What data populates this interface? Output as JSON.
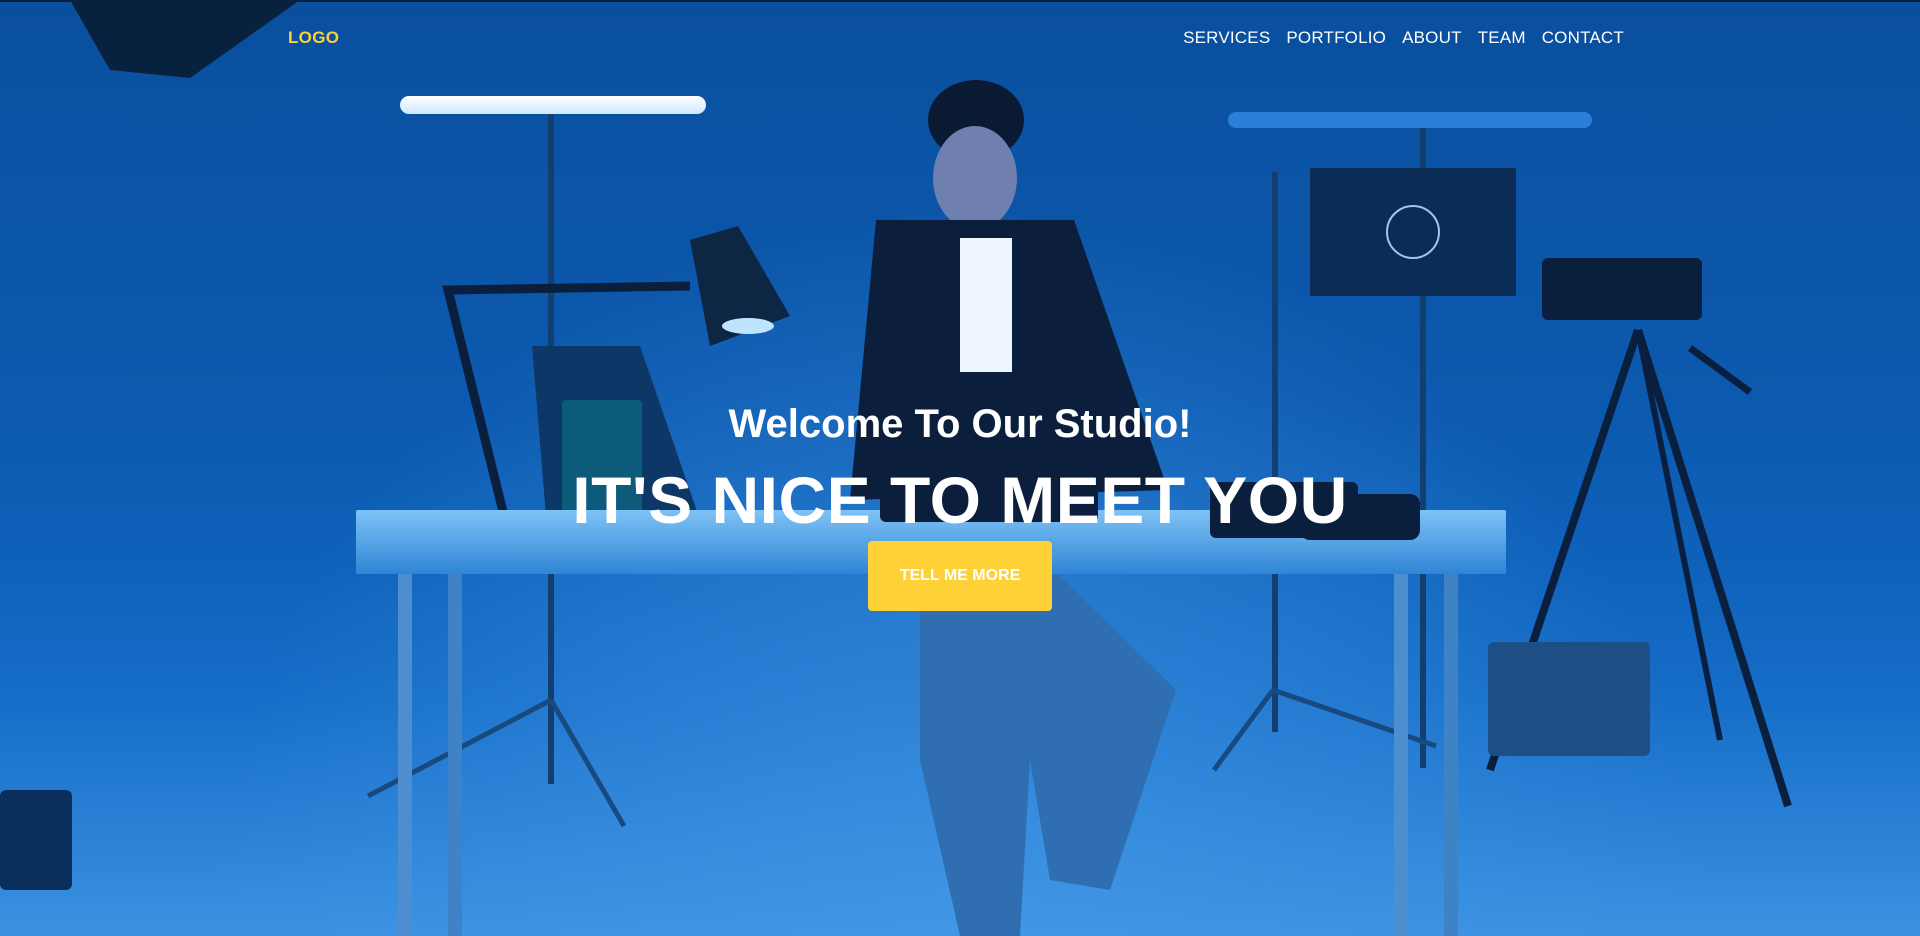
{
  "nav": {
    "logo": "LOGO",
    "links": [
      "SERVICES",
      "PORTFOLIO",
      "ABOUT",
      "TEAM",
      "CONTACT"
    ]
  },
  "hero": {
    "lead": "Welcome To Our Studio!",
    "heading": "IT'S NICE TO MEET YOU",
    "cta_label": "TELL ME MORE",
    "background_image": "photo studio with man at laptop on desk, blue lighting"
  },
  "colors": {
    "accent": "#fed136",
    "text": "#ffffff",
    "background": "#0c5ab0"
  }
}
